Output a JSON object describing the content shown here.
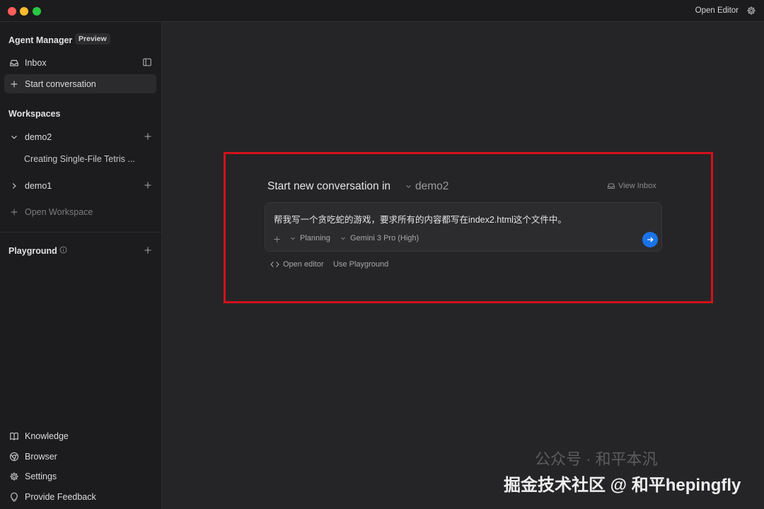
{
  "titlebar": {
    "open_editor": "Open Editor"
  },
  "sidebar": {
    "agent_manager": "Agent Manager",
    "preview": "Preview",
    "inbox": "Inbox",
    "start_conversation": "Start conversation",
    "workspaces": "Workspaces",
    "workspace_items": [
      {
        "name": "demo2",
        "expanded": true,
        "conversations": [
          "Creating Single-File Tetris ..."
        ]
      },
      {
        "name": "demo1",
        "expanded": false
      }
    ],
    "open_workspace": "Open Workspace",
    "playground": "Playground",
    "bottom_items": [
      "Knowledge",
      "Browser",
      "Settings",
      "Provide Feedback"
    ]
  },
  "main": {
    "title": "Start new conversation in",
    "workspace": "demo2",
    "view_inbox": "View Inbox",
    "prompt": "帮我写一个贪吃蛇的游戏，要求所有的内容都写在index2.html这个文件中。",
    "mode": "Planning",
    "model": "Gemini 3 Pro (High)",
    "open_editor": "Open editor",
    "use_playground": "Use Playground"
  },
  "watermark": {
    "faint": "公众号 · 和平本汎",
    "main": "掘金技术社区 @ 和平hepingfly"
  },
  "colors": {
    "accent": "#1b73e8",
    "highlight": "#d4111b"
  }
}
